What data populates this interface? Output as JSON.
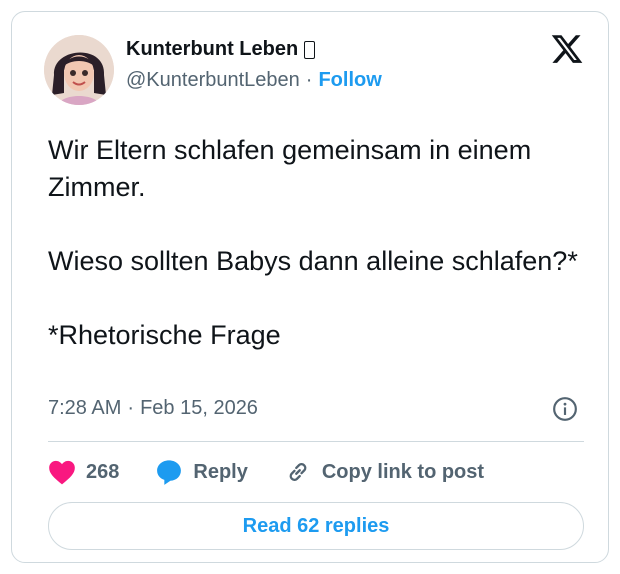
{
  "author": {
    "display_name": "Kunterbunt Leben",
    "handle": "@KunterbuntLeben",
    "separator": "·",
    "follow_label": "Follow"
  },
  "tweet": {
    "text": "Wir Eltern schlafen gemeinsam in einem Zimmer.\n\nWieso sollten Babys dann alleine schlafen?*\n\n*Rhetorische Frage",
    "time": "7:28 AM",
    "separator": "·",
    "date": "Feb 15, 2026"
  },
  "actions": {
    "like_count": "268",
    "reply_label": "Reply",
    "copy_label": "Copy link to post"
  },
  "read_replies_label": "Read 62 replies",
  "colors": {
    "accent": "#1d9bf0",
    "like": "#f91880",
    "text": "#0f1419",
    "muted": "#536471",
    "border": "#cfd9de"
  },
  "icons": [
    "x-logo-icon",
    "info-icon",
    "heart-icon",
    "reply-bubble-icon",
    "link-icon"
  ]
}
